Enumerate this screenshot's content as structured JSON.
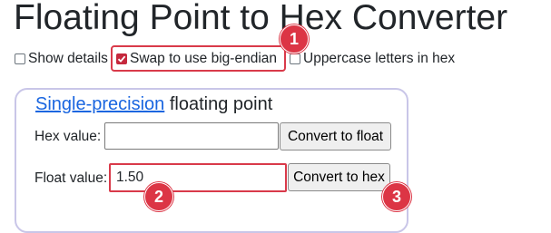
{
  "page": {
    "title": "Floating Point to Hex Converter"
  },
  "options": [
    {
      "label": "Show details",
      "checked": false
    },
    {
      "label": "Swap to use big-endian",
      "checked": true
    },
    {
      "label": "Uppercase letters in hex",
      "checked": false
    }
  ],
  "panel": {
    "title_link": "Single-precision",
    "title_rest": " floating point",
    "hex_label": "Hex value:",
    "hex_value": "",
    "convert_to_float": "Convert to float",
    "float_label": "Float value:",
    "float_value": "1.50",
    "convert_to_hex": "Convert to hex"
  },
  "annotations": {
    "badge1": "1",
    "badge2": "2",
    "badge3": "3"
  },
  "colors": {
    "accent": "#dc3545",
    "link": "#1a66e0",
    "panel_border": "#c9c6e8"
  }
}
